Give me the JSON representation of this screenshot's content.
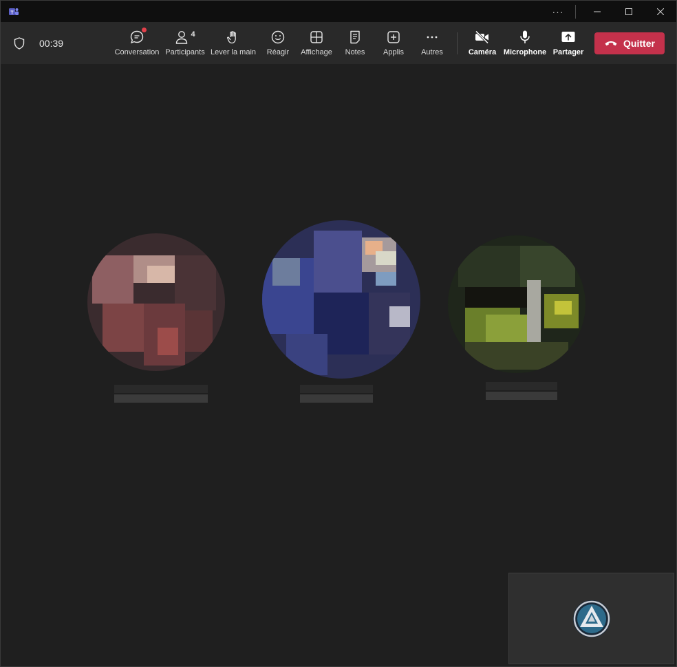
{
  "window": {
    "title": "",
    "more_label": "···"
  },
  "toolbar": {
    "timer": "00:39",
    "items": [
      {
        "label": "Conversation",
        "icon": "chat-icon"
      },
      {
        "label": "Participants",
        "icon": "people-icon",
        "count": "4"
      },
      {
        "label": "Lever la main",
        "icon": "raise-hand-icon"
      },
      {
        "label": "Réagir",
        "icon": "smiley-icon"
      },
      {
        "label": "Affichage",
        "icon": "grid-icon"
      },
      {
        "label": "Notes",
        "icon": "notes-icon"
      },
      {
        "label": "Applis",
        "icon": "add-app-icon"
      },
      {
        "label": "Autres",
        "icon": "more-icon"
      },
      {
        "label": "Caméra",
        "icon": "camera-off-icon"
      },
      {
        "label": "Microphone",
        "icon": "microphone-icon"
      },
      {
        "label": "Partager",
        "icon": "share-icon"
      }
    ],
    "leave_label": "Quitter"
  },
  "colors": {
    "leave": "#c4314b",
    "badge": "#e3414b",
    "background": "#1f1f1f"
  }
}
